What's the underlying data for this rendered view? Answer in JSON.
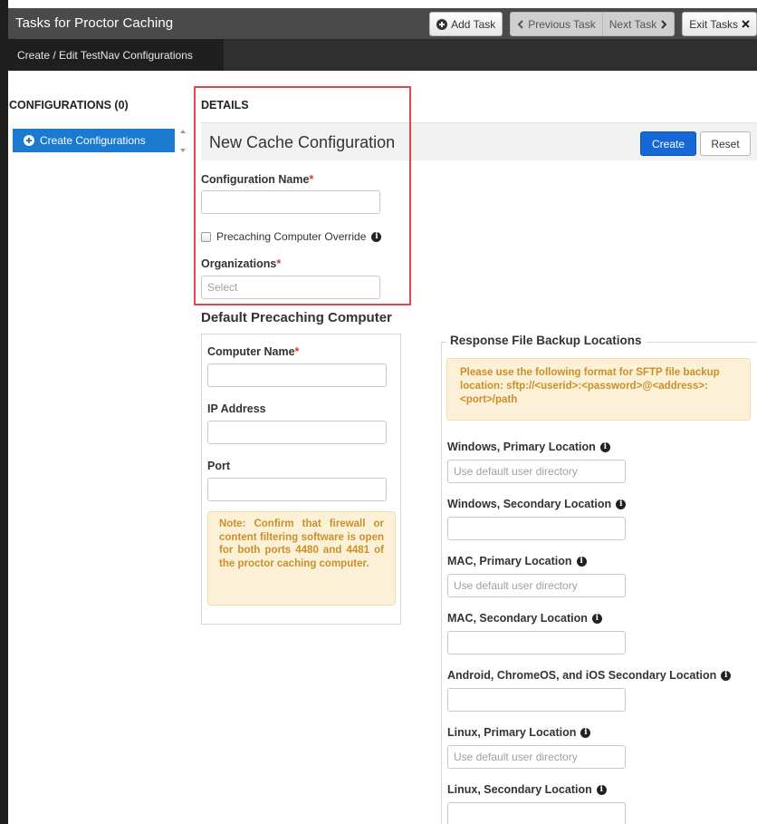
{
  "header": {
    "title": "Tasks for Proctor Caching",
    "add_task": "Add Task",
    "previous_task": "Previous Task",
    "next_task": "Next Task",
    "exit_tasks": "Exit Tasks"
  },
  "subnav": {
    "active_tab": "Create / Edit TestNav Configurations"
  },
  "sidebar": {
    "title": "CONFIGURATIONS (0)",
    "items": [
      {
        "label": "Create Configurations"
      }
    ]
  },
  "details": {
    "label": "DETAILS",
    "heading": "New Cache Configuration",
    "create_label": "Create",
    "reset_label": "Reset",
    "config_name_label": "Configuration Name",
    "precaching_override_label": "Precaching Computer Override",
    "organizations_label": "Organizations",
    "organizations_placeholder": "Select",
    "required_marker": "*"
  },
  "default_precaching": {
    "title": "Default Precaching Computer",
    "computer_name_label": "Computer Name",
    "ip_address_label": "IP Address",
    "port_label": "Port",
    "note": "Note: Confirm that firewall or content filtering software is open for both ports 4480 and 4481 of the proctor caching computer."
  },
  "backup_locations": {
    "title": "Response File Backup Locations",
    "sftp_note": "Please use the following format for SFTP file backup location: sftp://<userid>:<password>@<address>:<port>/path",
    "default_placeholder": "Use default user directory",
    "windows_primary": "Windows, Primary Location",
    "windows_secondary": "Windows, Secondary Location",
    "mac_primary": "MAC, Primary Location",
    "mac_secondary": "MAC, Secondary Location",
    "android_secondary": "Android, ChromeOS, and iOS Secondary Location",
    "linux_primary": "Linux, Primary Location",
    "linux_secondary": "Linux, Secondary Location"
  },
  "icons": {
    "info": "info-circle-icon",
    "add": "plus-circle-icon",
    "prev": "chevron-left-icon",
    "next": "chevron-right-icon",
    "close": "close-icon"
  },
  "colors": {
    "primary_button": "#1668d6",
    "required": "#d63b3b",
    "highlight_box": "#e0464b",
    "note_bg": "#fcf1d6",
    "note_text": "#c8902a",
    "header_bg": "#4a4a4a"
  }
}
